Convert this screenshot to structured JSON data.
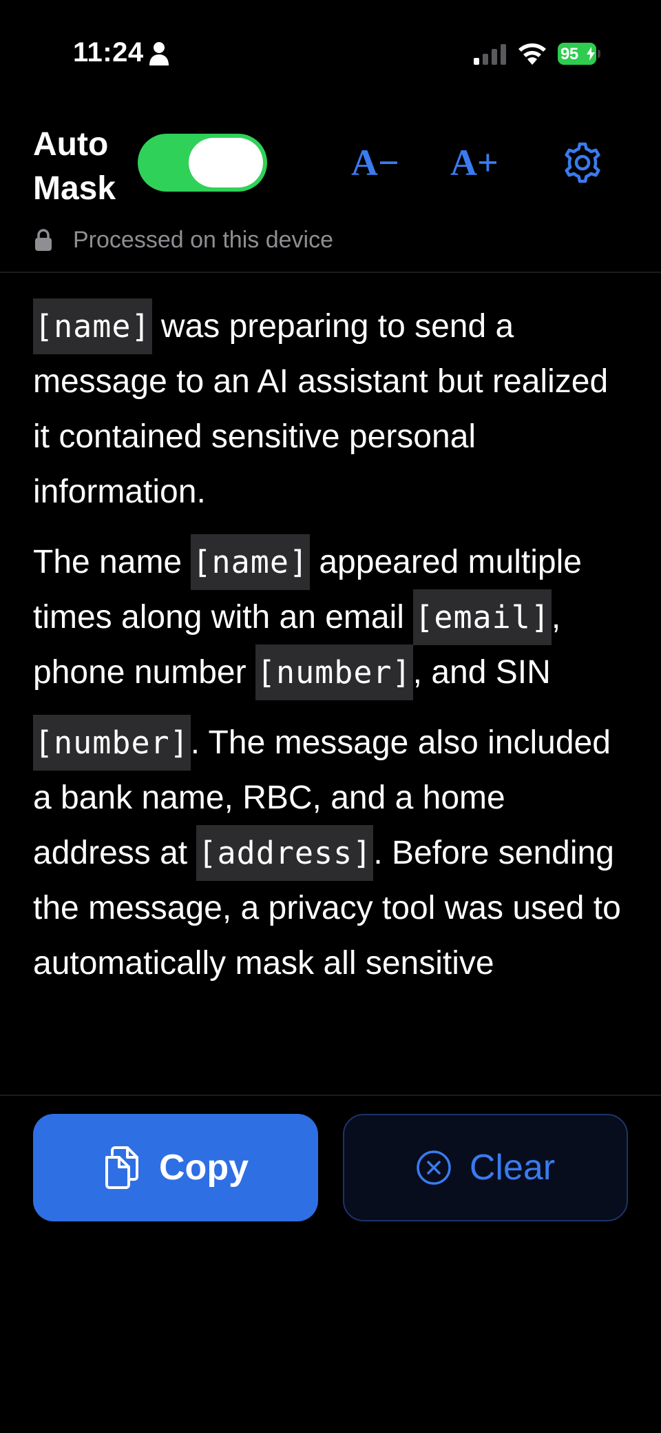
{
  "status_bar": {
    "time": "11:24",
    "battery_level": "95",
    "icons": [
      "person-icon",
      "signal-icon",
      "wifi-icon",
      "battery-icon",
      "charging-bolt-icon"
    ]
  },
  "header": {
    "auto_mask_label": "Auto Mask",
    "auto_mask_on": true,
    "font_decrease_label": "A−",
    "font_increase_label": "A+",
    "settings_icon": "gear-icon",
    "device_note": "Processed on this device",
    "device_note_icon": "lock-icon"
  },
  "content": {
    "p1": {
      "mask1": "[name]",
      "t1": " was preparing to send a message to an AI assistant but realized it contained sensitive personal information."
    },
    "p2": {
      "t1": "The name ",
      "mask1": "[name]",
      "t2": " appeared multiple times along with an email ",
      "mask2": "[email]",
      "t3": ", phone number ",
      "mask3": "[number]",
      "t4": ", and SIN"
    },
    "p3": {
      "mask1": "[number]",
      "t1": ". The message also included a bank name, RBC, and a home address at ",
      "mask2": "[address]",
      "t2": ". Before sending the message, a privacy tool was used to automatically mask all sensitive"
    }
  },
  "actions": {
    "copy_label": "Copy",
    "copy_icon": "copy-icon",
    "clear_label": "Clear",
    "clear_icon": "clear-circle-x-icon"
  },
  "colors": {
    "accent": "#2f6fe4",
    "toggle_on": "#30d158",
    "background": "#000000",
    "mask_background": "#2c2c2e"
  }
}
